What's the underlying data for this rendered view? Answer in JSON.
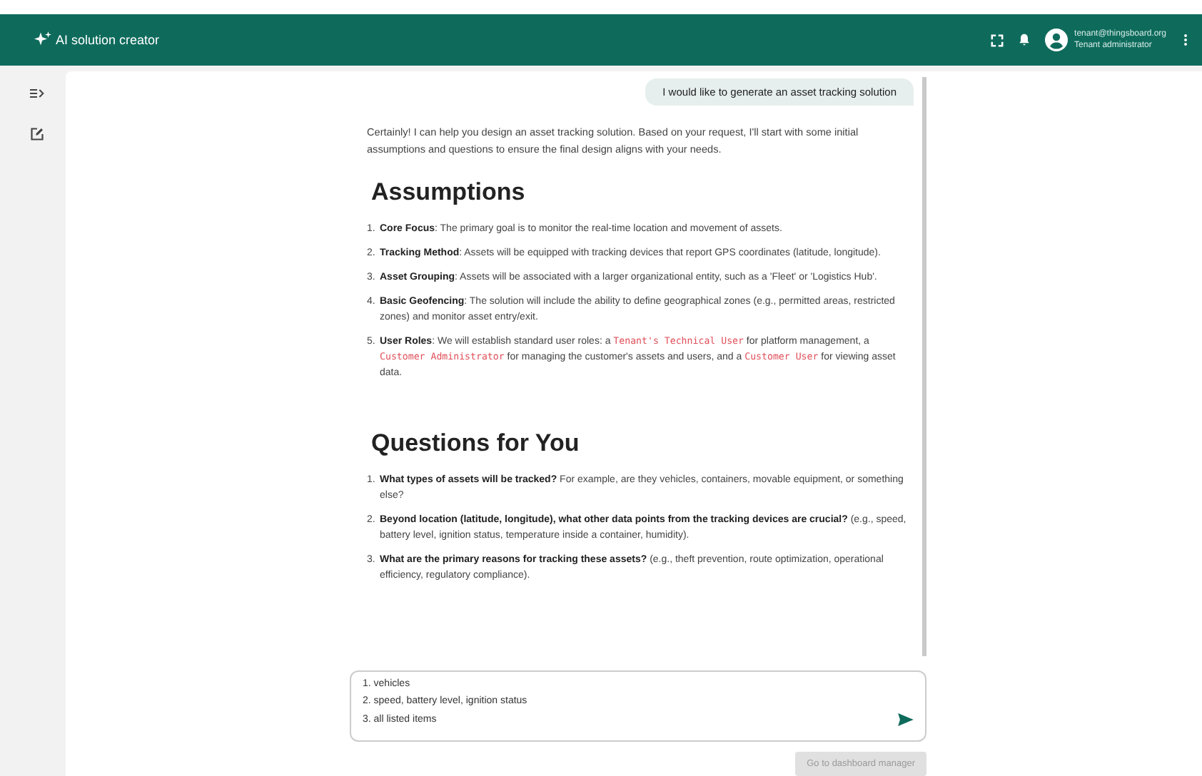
{
  "header": {
    "title": "AI solution creator",
    "user_email": "tenant@thingsboard.org",
    "user_role": "Tenant administrator"
  },
  "chat": {
    "user_message": "I would like to generate an asset tracking solution",
    "intro": "Certainly! I can help you design an asset tracking solution. Based on your request, I'll start with some initial assumptions and questions to ensure the final design aligns with your needs.",
    "sections": [
      {
        "heading": "Assumptions",
        "items": [
          {
            "number": "1.",
            "parts": [
              {
                "kind": "bold",
                "text": "Core Focus"
              },
              {
                "kind": "text",
                "text": ": The primary goal is to monitor the real-time location and movement of assets."
              }
            ]
          },
          {
            "number": "2.",
            "parts": [
              {
                "kind": "bold",
                "text": "Tracking Method"
              },
              {
                "kind": "text",
                "text": ": Assets will be equipped with tracking devices that report GPS coordinates (latitude, longitude)."
              }
            ]
          },
          {
            "number": "3.",
            "parts": [
              {
                "kind": "bold",
                "text": "Asset Grouping"
              },
              {
                "kind": "text",
                "text": ": Assets will be associated with a larger organizational entity, such as a 'Fleet' or 'Logistics Hub'."
              }
            ]
          },
          {
            "number": "4.",
            "parts": [
              {
                "kind": "bold",
                "text": "Basic Geofencing"
              },
              {
                "kind": "text",
                "text": ": The solution will include the ability to define geographical zones (e.g., permitted areas, restricted zones) and monitor asset entry/exit."
              }
            ]
          },
          {
            "number": "5.",
            "parts": [
              {
                "kind": "bold",
                "text": "User Roles"
              },
              {
                "kind": "text",
                "text": ": We will establish standard user roles: a "
              },
              {
                "kind": "code",
                "text": "Tenant's Technical User"
              },
              {
                "kind": "text",
                "text": " for platform management, a "
              },
              {
                "kind": "code",
                "text": "Customer Administrator"
              },
              {
                "kind": "text",
                "text": " for managing the customer's assets and users, and a "
              },
              {
                "kind": "code",
                "text": "Customer User"
              },
              {
                "kind": "text",
                "text": " for viewing asset data."
              }
            ]
          }
        ]
      },
      {
        "heading": "Questions for You",
        "items": [
          {
            "number": "1.",
            "parts": [
              {
                "kind": "bold",
                "text": "What types of assets will be tracked?"
              },
              {
                "kind": "text",
                "text": " For example, are they vehicles, containers, movable equipment, or something else?"
              }
            ]
          },
          {
            "number": "2.",
            "parts": [
              {
                "kind": "bold",
                "text": "Beyond location (latitude, longitude), what other data points from the tracking devices are crucial?"
              },
              {
                "kind": "text",
                "text": " (e.g., speed, battery level, ignition status, temperature inside a container, humidity)."
              }
            ]
          },
          {
            "number": "3.",
            "parts": [
              {
                "kind": "bold",
                "text": "What are the primary reasons for tracking these assets?"
              },
              {
                "kind": "text",
                "text": " (e.g., theft prevention, route optimization, operational efficiency, regulatory compliance)."
              }
            ]
          }
        ]
      }
    ]
  },
  "input": {
    "lines": [
      "1. vehicles",
      "2. speed, battery level, ignition status",
      "3. all listed items"
    ]
  },
  "dashboard_button": {
    "label": "Go to dashboard manager",
    "disabled": true
  }
}
